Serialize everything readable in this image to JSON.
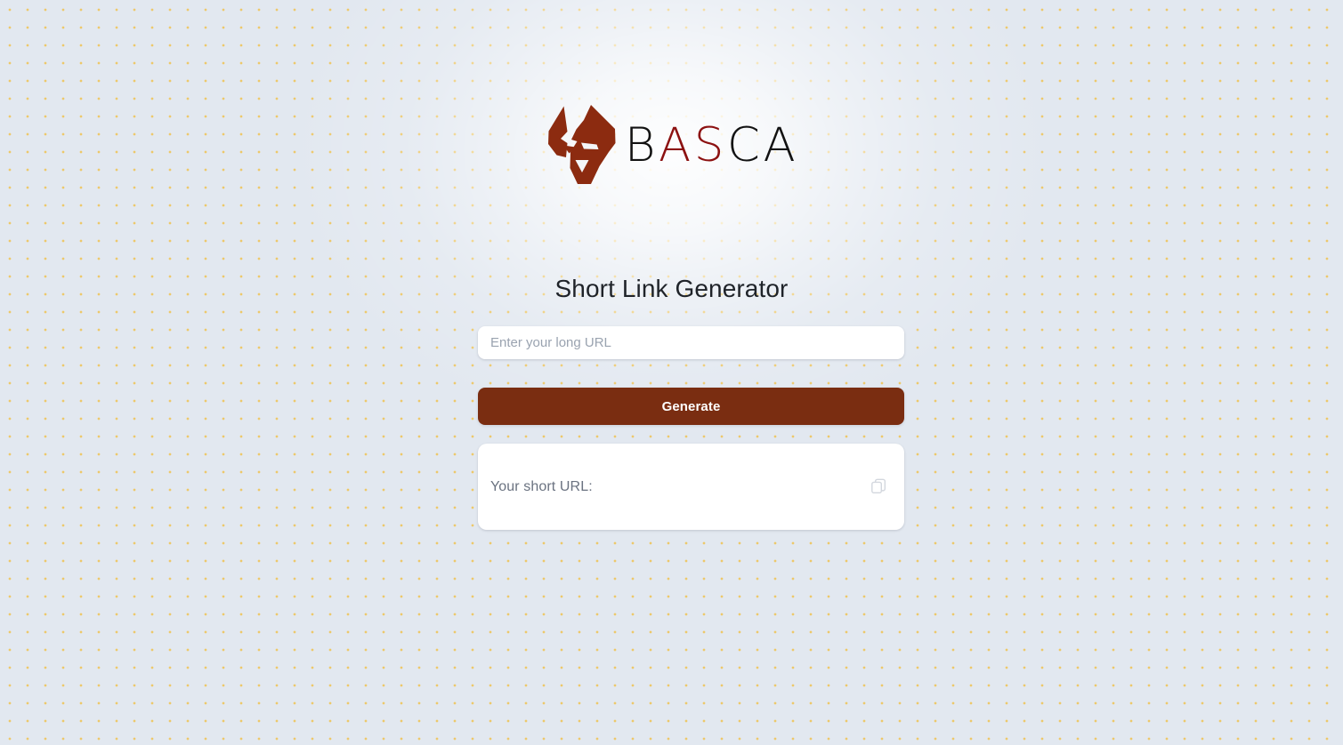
{
  "brand": {
    "logo_icon": "wolf-head-icon",
    "wordmark_parts": [
      {
        "text": "B",
        "color": "#121212"
      },
      {
        "text": "A",
        "color": "#8c1111"
      },
      {
        "text": "S",
        "color": "#8c1111"
      },
      {
        "text": "C",
        "color": "#121212"
      },
      {
        "text": "A",
        "color": "#121212"
      }
    ],
    "wordmark_full": "BASCA",
    "mark_color": "#8c2b10"
  },
  "page": {
    "title": "Short Link Generator"
  },
  "form": {
    "url_input": {
      "value": "",
      "placeholder": "Enter your long URL"
    },
    "generate_label": "Generate",
    "generate_color": "#7a2d11"
  },
  "result": {
    "label": "Your short URL:",
    "value": "",
    "copy_icon": "copy-icon"
  },
  "theme": {
    "background": "#e2e8f0",
    "dot_color": "#edc86a",
    "card_background": "#ffffff",
    "accent": "#7a2d11",
    "brand_red": "#8c1111",
    "muted_text": "#6a7280",
    "placeholder_text": "#9aa3b0"
  }
}
